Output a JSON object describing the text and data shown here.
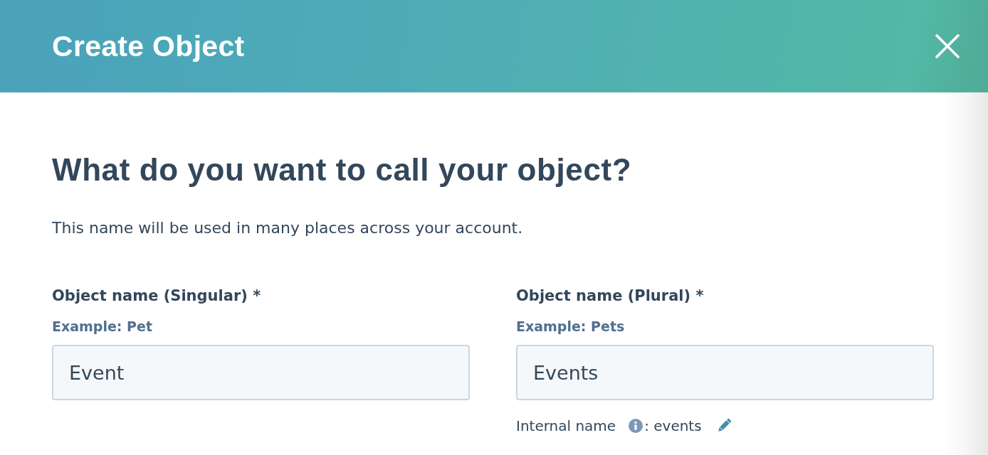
{
  "header": {
    "title": "Create Object"
  },
  "intro": {
    "heading": "What do you want to call your object?",
    "description": "This name will be used in many places across your account."
  },
  "fields": [
    {
      "label": "Object name (Singular) *",
      "example": "Example: Pet",
      "value": "Event"
    },
    {
      "label": "Object name (Plural) *",
      "example": "Example: Pets",
      "value": "Events",
      "internal_name": {
        "label": "Internal name",
        "value": ": events"
      }
    }
  ]
}
